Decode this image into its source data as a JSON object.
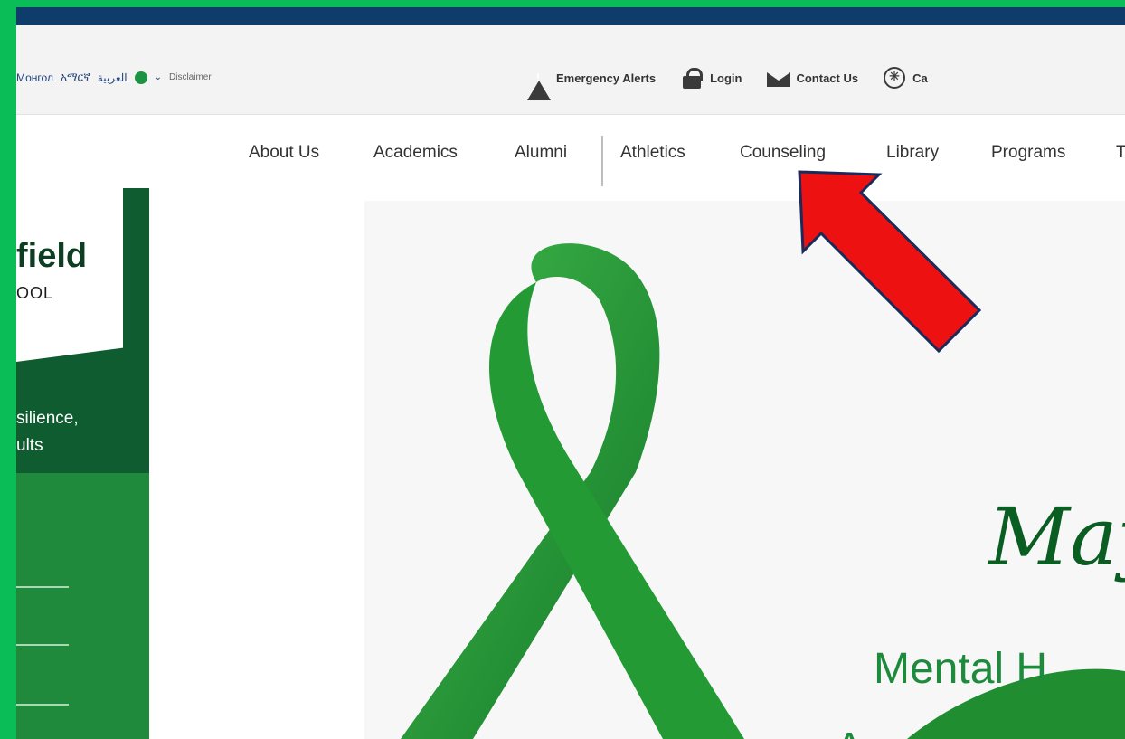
{
  "language_bar": {
    "langs": [
      "Монгол",
      "አማርኛ",
      "العربية"
    ],
    "disclaimer": "Disclaimer",
    "icons": [
      "globe-icon",
      "chevron-down-icon"
    ]
  },
  "utility_links": [
    {
      "label": "Emergency Alerts",
      "icon": "alert-triangle-icon"
    },
    {
      "label": "Login",
      "icon": "lock-icon"
    },
    {
      "label": "Contact Us",
      "icon": "envelope-icon"
    },
    {
      "label": "Ca",
      "icon": "calendar-icon"
    }
  ],
  "nav": {
    "items": [
      "About Us",
      "Academics",
      "Alumni",
      "Athletics",
      "Counseling",
      "Library",
      "Programs",
      "T"
    ]
  },
  "brand": {
    "name": "field",
    "subtitle": "OOL",
    "mission_line1": "silience,",
    "mission_line2": "ults"
  },
  "hero": {
    "script_text": "May",
    "headline_1": "Mental H",
    "headline_2": "Awareness"
  },
  "colors": {
    "frame_border": "#0bbd57",
    "top_strip": "#0f3d6b",
    "brand_dark": "#105c31",
    "brand_green": "#1f8a3c",
    "ribbon_green": "#2a9b35",
    "arrow_red": "#ee1111",
    "arrow_outline": "#1a2a5a"
  }
}
